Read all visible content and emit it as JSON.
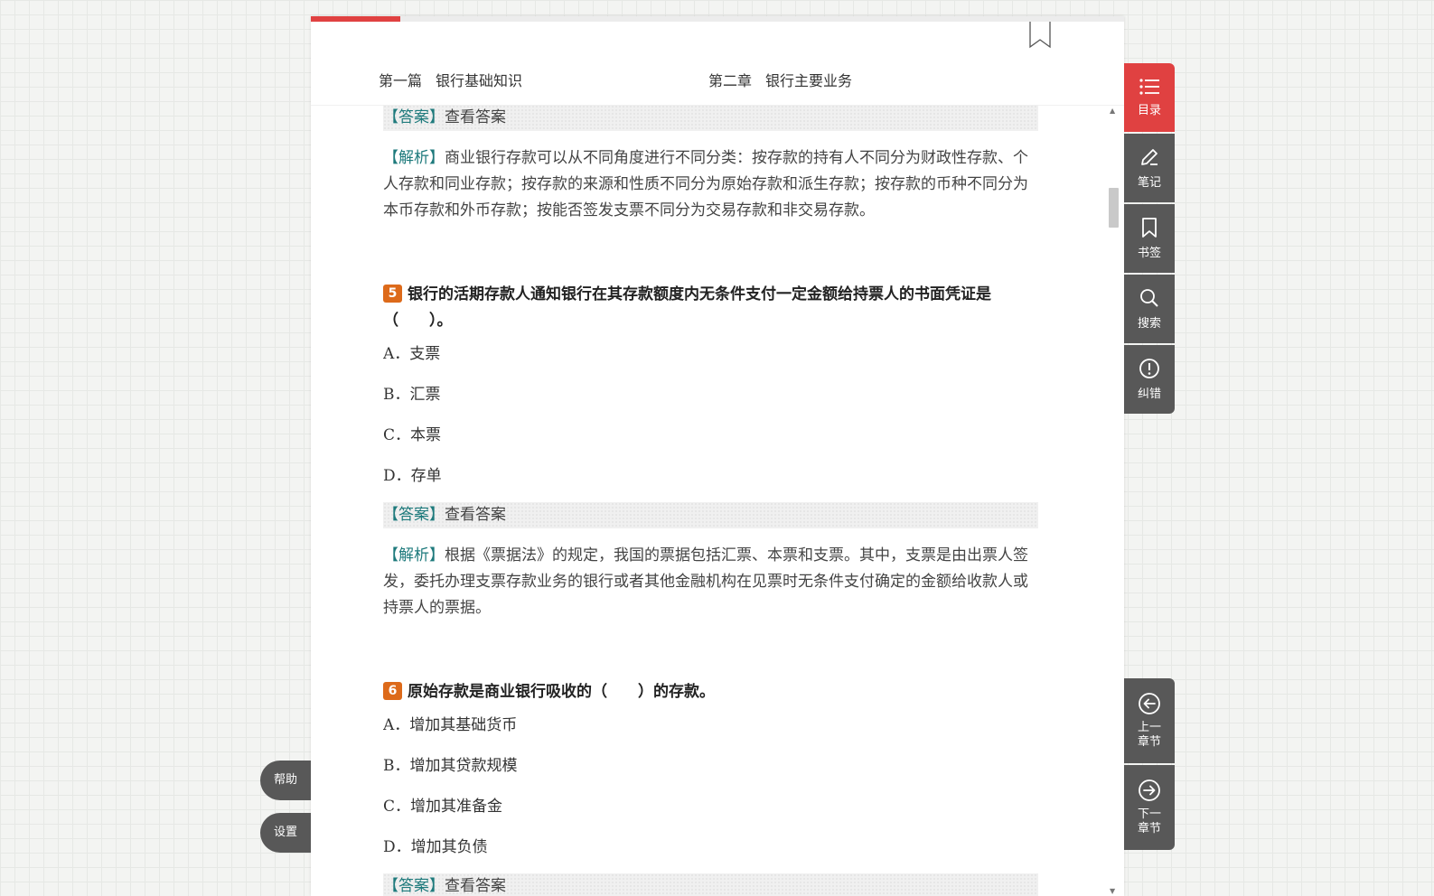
{
  "header": {
    "part": "第一篇",
    "part_title": "银行基础知识",
    "chapter": "第二章",
    "chapter_title": "银行主要业务"
  },
  "reading_progress": 0.11,
  "content": {
    "answer_label": "【答案】",
    "answer_link": "查看答案",
    "explain_label": "【解析】",
    "explain_prev": "商业银行存款可以从不同角度进行不同分类：按存款的持有人不同分为财政性存款、个人存款和同业存款；按存款的来源和性质不同分为原始存款和派生存款；按存款的币种不同分为本币存款和外币存款；按能否签发支票不同分为交易存款和非交易存款。",
    "q5": {
      "number": "5",
      "text": "银行的活期存款人通知银行在其存款额度内无条件支付一定金额给持票人的书面凭证是（　　）。",
      "options": [
        "A．支票",
        "B．汇票",
        "C．本票",
        "D．存单"
      ],
      "explain": "根据《票据法》的规定，我国的票据包括汇票、本票和支票。其中，支票是由出票人签发，委托办理支票存款业务的银行或者其他金融机构在见票时无条件支付确定的金额给收款人或持票人的票据。"
    },
    "q6": {
      "number": "6",
      "text": "原始存款是商业银行吸收的（　　）的存款。",
      "options": [
        "A．增加其基础货币",
        "B．增加其贷款规模",
        "C．增加其准备金",
        "D．增加其负债"
      ]
    }
  },
  "sidebar": {
    "items": [
      {
        "label": "目录",
        "icon": "list-icon"
      },
      {
        "label": "笔记",
        "icon": "pencil-icon"
      },
      {
        "label": "书签",
        "icon": "bookmark-icon"
      },
      {
        "label": "搜索",
        "icon": "search-icon"
      },
      {
        "label": "纠错",
        "icon": "alert-icon"
      }
    ]
  },
  "chapter_nav": {
    "prev_line1": "上一",
    "prev_line2": "章节",
    "next_line1": "下一",
    "next_line2": "章节"
  },
  "left_buttons": {
    "help": "帮助",
    "settings": "设置"
  },
  "colors": {
    "accent_red": "#e04141",
    "rail_gray": "#585858",
    "label_teal": "#1e7a7c",
    "qnum_orange": "#dd6a1a"
  }
}
